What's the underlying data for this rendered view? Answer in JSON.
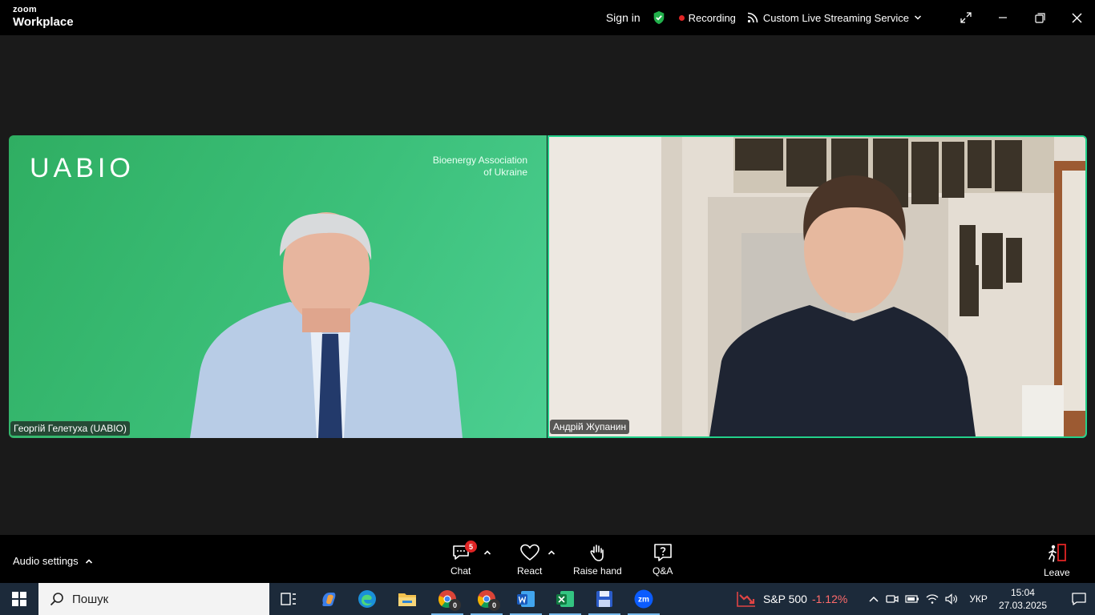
{
  "titlebar": {
    "brand_top": "zoom",
    "brand_bottom": "Workplace",
    "sign_in": "Sign in",
    "recording": "Recording",
    "streaming": "Custom Live Streaming Service"
  },
  "videos": [
    {
      "name": "Георгій Гелетуха (UABIO)",
      "logo": "UABIO",
      "logo_sub_1": "Bioenergy Association",
      "logo_sub_2": "of Ukraine"
    },
    {
      "name": "Андрій Жупанин"
    }
  ],
  "toolbar": {
    "audio_settings": "Audio settings",
    "chat_label": "Chat",
    "chat_badge": "5",
    "react_label": "React",
    "raise_hand_label": "Raise hand",
    "qa_label": "Q&A",
    "leave_label": "Leave"
  },
  "taskbar": {
    "search_placeholder": "Пошук",
    "stock_name": "S&P 500",
    "stock_change": "-1.12%",
    "language": "УКР",
    "time": "15:04",
    "date": "27.03.2025",
    "chrome_badge_1": "0",
    "chrome_badge_2": "0"
  },
  "colors": {
    "active_speaker_border": "#23d18b",
    "record_dot": "#e02424",
    "shield_green": "#22b14c",
    "uabio_green": "#3cc07a"
  }
}
